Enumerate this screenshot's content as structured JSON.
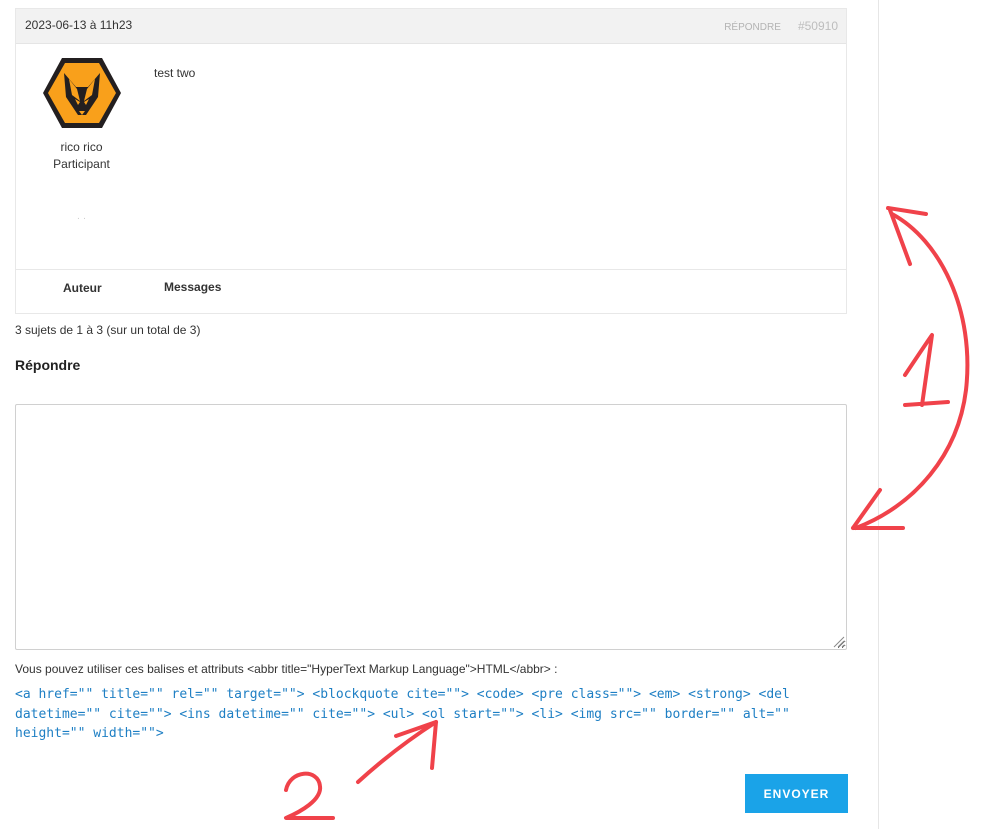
{
  "post": {
    "date": "2023-06-13 à 11h23",
    "reply_link": "Répondre",
    "post_id": "#50910",
    "author_name": "rico rico",
    "author_role": "Participant",
    "author_extra": "· ·",
    "content": "test two",
    "avatar_icon": "wolf-head-icon"
  },
  "table_footer": {
    "col_author": "Auteur",
    "col_messages": "Messages"
  },
  "pagination": {
    "count_text": "3 sujets de 1 à 3 (sur un total de 3)"
  },
  "reply_form": {
    "title": "Répondre",
    "textarea_value": "",
    "allowed_tags_label": "Vous pouvez utiliser ces balises et attributs <abbr title=\"HyperText Markup Language\">HTML</abbr> :",
    "allowed_tags_code": "<a href=\"\" title=\"\" rel=\"\" target=\"\"> <blockquote cite=\"\"> <code> <pre class=\"\"> <em> <strong> <del datetime=\"\" cite=\"\"> <ins datetime=\"\" cite=\"\"> <ul> <ol start=\"\"> <li> <img src=\"\" border=\"\" alt=\"\" height=\"\" width=\"\">",
    "submit_label": "ENVOYER"
  },
  "annotations": {
    "label_one": "1",
    "label_two": "2",
    "color": "#f0424a"
  },
  "colors": {
    "accent": "#1aa3e8",
    "link": "#1e7fc4",
    "header_bg": "#f2f2f2",
    "annotation": "#f0424a"
  }
}
